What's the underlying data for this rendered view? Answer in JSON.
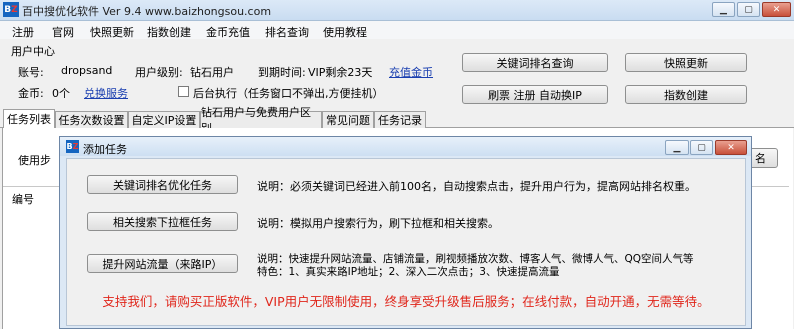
{
  "window": {
    "title": "百中搜优化软件 Ver 9.4 www.baizhongsou.com",
    "logo_text": "BZ"
  },
  "menu": [
    "注册",
    "官网",
    "快照更新",
    "指数创建",
    "金币充值",
    "排名查询",
    "使用教程"
  ],
  "user_center": {
    "group_title": "用户中心",
    "account_label": "账号:",
    "account_value": "dropsand",
    "level_label": "用户级别:",
    "level_value": "钻石用户",
    "expire_label": "到期时间:",
    "expire_value": "VIP剩余23天",
    "recharge_link": "充值金币",
    "coins_label": "金币:",
    "coins_value": "0个",
    "exchange_link": "兑换服务",
    "background_checkbox": "后台执行（任务窗口不弹出,方便挂机）",
    "buttons": {
      "rank_query": "关键词排名查询",
      "snapshot_update": "快照更新",
      "refresh_register": "刷票 注册 自动换IP",
      "index_create": "指数创建"
    }
  },
  "tabs": [
    "任务列表",
    "任务次数设置",
    "自定义IP设置",
    "钻石用户与免费用户区别",
    "常见问题",
    "任务记录"
  ],
  "task_panel": {
    "use_label": "使用步",
    "right_button_partial": "名",
    "column_header": "编号"
  },
  "dialog": {
    "title": "添加任务",
    "tasks": [
      {
        "button": "关键词排名优化任务",
        "description": "说明：必须关键词已经进入前100名，自动搜索点击，提升用户行为，提高网站排名权重。"
      },
      {
        "button": "相关搜索下拉框任务",
        "description": "说明：模拟用户搜索行为，刷下拉框和相关搜索。"
      },
      {
        "button": "提升网站流量（来路IP）",
        "description": "说明：快速提升网站流量、店铺流量，刷视频播放次数、博客人气、微博人气、QQ空间人气等",
        "feature": "特色：1、真实来路IP地址；2、深入二次点击；3、快速提高流量"
      }
    ],
    "footer_notice": "支持我们，请购买正版软件，VIP用户无限制使用，终身享受升级售后服务；在线付款，自动开通，无需等待。"
  }
}
